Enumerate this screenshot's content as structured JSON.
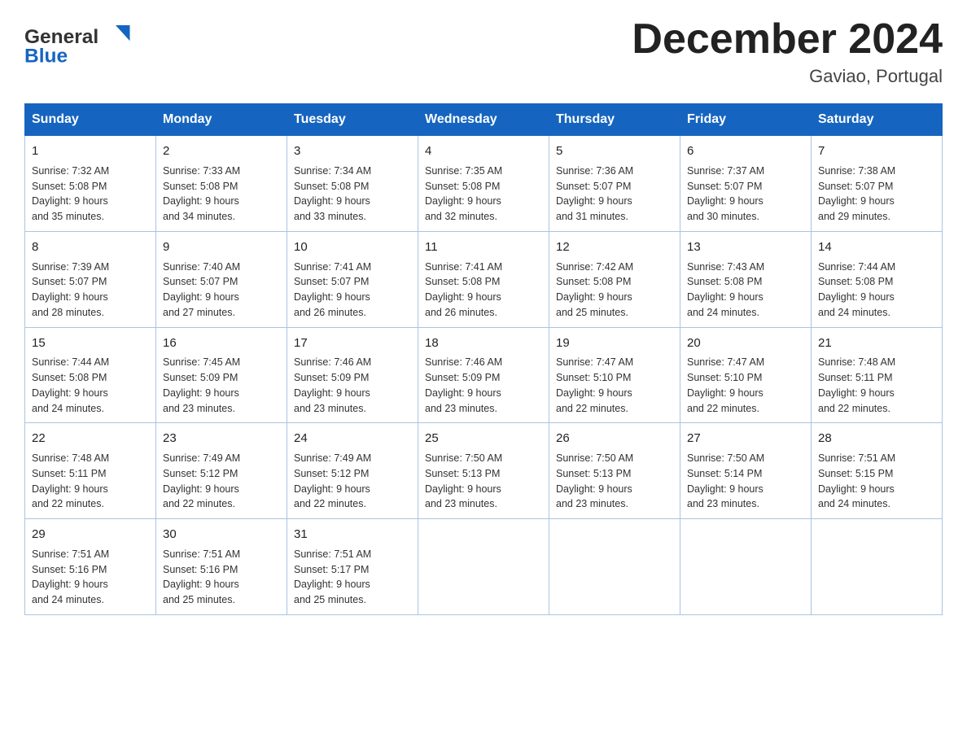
{
  "header": {
    "logo_general": "General",
    "logo_blue": "Blue",
    "month_title": "December 2024",
    "location": "Gaviao, Portugal"
  },
  "calendar": {
    "days_of_week": [
      "Sunday",
      "Monday",
      "Tuesday",
      "Wednesday",
      "Thursday",
      "Friday",
      "Saturday"
    ],
    "weeks": [
      [
        {
          "day": "1",
          "sunrise": "7:32 AM",
          "sunset": "5:08 PM",
          "daylight": "9 hours and 35 minutes."
        },
        {
          "day": "2",
          "sunrise": "7:33 AM",
          "sunset": "5:08 PM",
          "daylight": "9 hours and 34 minutes."
        },
        {
          "day": "3",
          "sunrise": "7:34 AM",
          "sunset": "5:08 PM",
          "daylight": "9 hours and 33 minutes."
        },
        {
          "day": "4",
          "sunrise": "7:35 AM",
          "sunset": "5:08 PM",
          "daylight": "9 hours and 32 minutes."
        },
        {
          "day": "5",
          "sunrise": "7:36 AM",
          "sunset": "5:07 PM",
          "daylight": "9 hours and 31 minutes."
        },
        {
          "day": "6",
          "sunrise": "7:37 AM",
          "sunset": "5:07 PM",
          "daylight": "9 hours and 30 minutes."
        },
        {
          "day": "7",
          "sunrise": "7:38 AM",
          "sunset": "5:07 PM",
          "daylight": "9 hours and 29 minutes."
        }
      ],
      [
        {
          "day": "8",
          "sunrise": "7:39 AM",
          "sunset": "5:07 PM",
          "daylight": "9 hours and 28 minutes."
        },
        {
          "day": "9",
          "sunrise": "7:40 AM",
          "sunset": "5:07 PM",
          "daylight": "9 hours and 27 minutes."
        },
        {
          "day": "10",
          "sunrise": "7:41 AM",
          "sunset": "5:07 PM",
          "daylight": "9 hours and 26 minutes."
        },
        {
          "day": "11",
          "sunrise": "7:41 AM",
          "sunset": "5:08 PM",
          "daylight": "9 hours and 26 minutes."
        },
        {
          "day": "12",
          "sunrise": "7:42 AM",
          "sunset": "5:08 PM",
          "daylight": "9 hours and 25 minutes."
        },
        {
          "day": "13",
          "sunrise": "7:43 AM",
          "sunset": "5:08 PM",
          "daylight": "9 hours and 24 minutes."
        },
        {
          "day": "14",
          "sunrise": "7:44 AM",
          "sunset": "5:08 PM",
          "daylight": "9 hours and 24 minutes."
        }
      ],
      [
        {
          "day": "15",
          "sunrise": "7:44 AM",
          "sunset": "5:08 PM",
          "daylight": "9 hours and 24 minutes."
        },
        {
          "day": "16",
          "sunrise": "7:45 AM",
          "sunset": "5:09 PM",
          "daylight": "9 hours and 23 minutes."
        },
        {
          "day": "17",
          "sunrise": "7:46 AM",
          "sunset": "5:09 PM",
          "daylight": "9 hours and 23 minutes."
        },
        {
          "day": "18",
          "sunrise": "7:46 AM",
          "sunset": "5:09 PM",
          "daylight": "9 hours and 23 minutes."
        },
        {
          "day": "19",
          "sunrise": "7:47 AM",
          "sunset": "5:10 PM",
          "daylight": "9 hours and 22 minutes."
        },
        {
          "day": "20",
          "sunrise": "7:47 AM",
          "sunset": "5:10 PM",
          "daylight": "9 hours and 22 minutes."
        },
        {
          "day": "21",
          "sunrise": "7:48 AM",
          "sunset": "5:11 PM",
          "daylight": "9 hours and 22 minutes."
        }
      ],
      [
        {
          "day": "22",
          "sunrise": "7:48 AM",
          "sunset": "5:11 PM",
          "daylight": "9 hours and 22 minutes."
        },
        {
          "day": "23",
          "sunrise": "7:49 AM",
          "sunset": "5:12 PM",
          "daylight": "9 hours and 22 minutes."
        },
        {
          "day": "24",
          "sunrise": "7:49 AM",
          "sunset": "5:12 PM",
          "daylight": "9 hours and 22 minutes."
        },
        {
          "day": "25",
          "sunrise": "7:50 AM",
          "sunset": "5:13 PM",
          "daylight": "9 hours and 23 minutes."
        },
        {
          "day": "26",
          "sunrise": "7:50 AM",
          "sunset": "5:13 PM",
          "daylight": "9 hours and 23 minutes."
        },
        {
          "day": "27",
          "sunrise": "7:50 AM",
          "sunset": "5:14 PM",
          "daylight": "9 hours and 23 minutes."
        },
        {
          "day": "28",
          "sunrise": "7:51 AM",
          "sunset": "5:15 PM",
          "daylight": "9 hours and 24 minutes."
        }
      ],
      [
        {
          "day": "29",
          "sunrise": "7:51 AM",
          "sunset": "5:16 PM",
          "daylight": "9 hours and 24 minutes."
        },
        {
          "day": "30",
          "sunrise": "7:51 AM",
          "sunset": "5:16 PM",
          "daylight": "9 hours and 25 minutes."
        },
        {
          "day": "31",
          "sunrise": "7:51 AM",
          "sunset": "5:17 PM",
          "daylight": "9 hours and 25 minutes."
        },
        null,
        null,
        null,
        null
      ]
    ]
  }
}
